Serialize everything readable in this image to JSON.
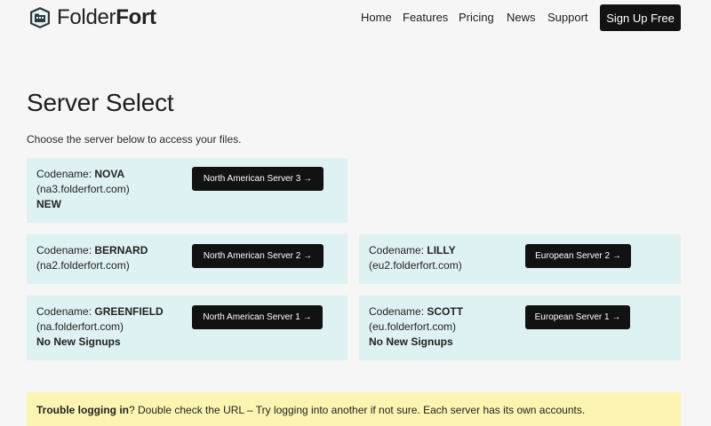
{
  "brand": {
    "name_regular": "Folder",
    "name_bold": "Fort",
    "logo_icon": "folder-fort-icon"
  },
  "nav": {
    "items": [
      {
        "label": "Home"
      },
      {
        "label": "Features"
      },
      {
        "label": "Pricing"
      },
      {
        "label": "News"
      },
      {
        "label": "Support"
      }
    ],
    "signup_label": "Sign Up Free"
  },
  "main": {
    "title": "Server Select",
    "subtitle": "Choose the server below to access your files."
  },
  "servers": [
    {
      "codename_label": "Codename: ",
      "codename": "NOVA",
      "host": "(na3.folderfort.com)",
      "status": "NEW",
      "button": "North American Server 3 →"
    },
    {
      "codename_label": "Codename: ",
      "codename": "BERNARD",
      "host": "(na2.folderfort.com)",
      "status": "",
      "button": "North American Server 2 →"
    },
    {
      "codename_label": "Codename: ",
      "codename": "LILLY",
      "host": "(eu2.folderfort.com)",
      "status": "",
      "button": "European Server 2 →"
    },
    {
      "codename_label": "Codename: ",
      "codename": "GREENFIELD",
      "host": "(na.folderfort.com)",
      "status": "No New Signups",
      "button": "North American Server 1 →"
    },
    {
      "codename_label": "Codename: ",
      "codename": "SCOTT",
      "host": "(eu.folderfort.com)",
      "status": "No New Signups",
      "button": "European Server 1 →"
    }
  ],
  "notice": {
    "bold": "Trouble logging in",
    "text": "? Double check the URL – Try logging into another if not sure. Each server has its own accounts."
  },
  "colors": {
    "card_bg": "#dff2f3",
    "notice_bg": "#fbf5b1",
    "button_bg": "#121212"
  }
}
